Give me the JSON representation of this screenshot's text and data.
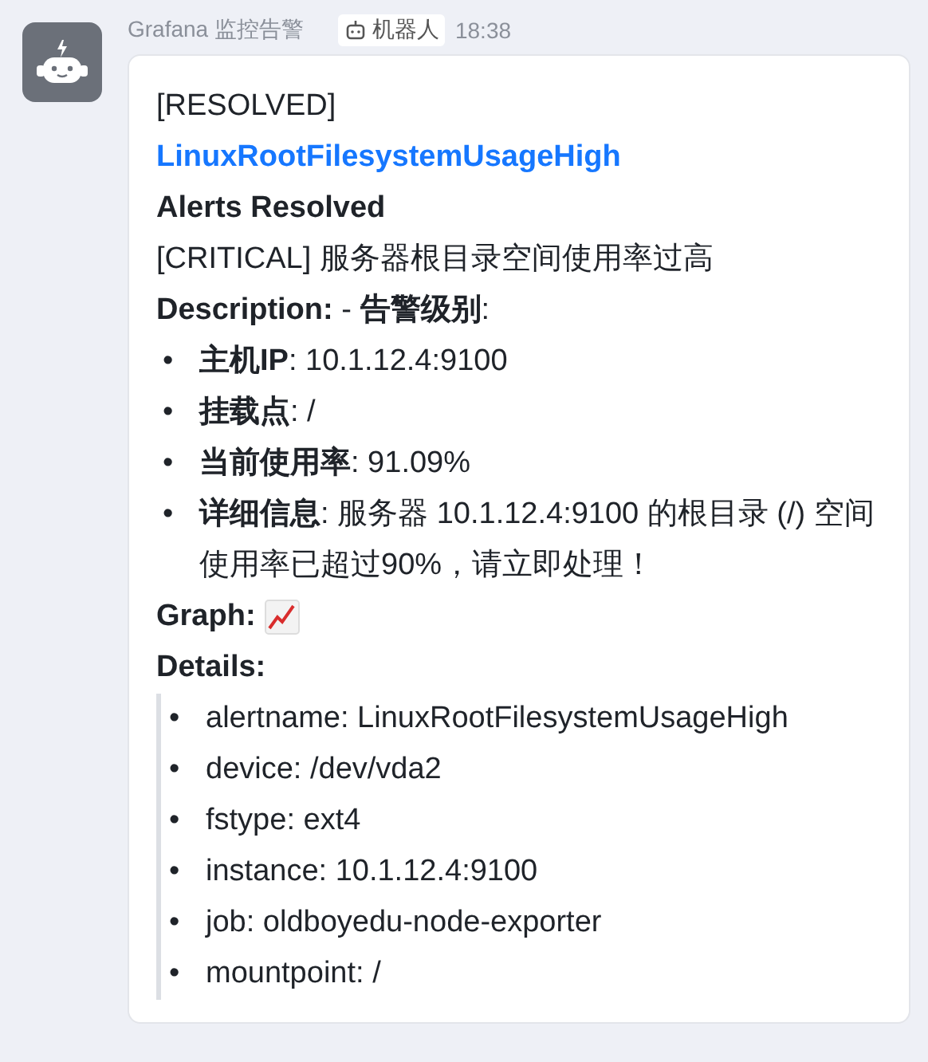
{
  "message": {
    "sender": "Grafana 监控告警",
    "badge": "机器人",
    "time": "18:38",
    "status": "[RESOLVED]",
    "alert_link": "LinuxRootFilesystemUsageHigh",
    "heading": "Alerts Resolved",
    "summary": "[CRITICAL] 服务器根目录空间使用率过高",
    "description": "**Description:** - **告警级别**:",
    "description_items": [
      {
        "marker": "•",
        "text": "**主机IP**: 10.1.12.4:9100"
      },
      {
        "marker": "•",
        "text": "**挂载点**: /"
      },
      {
        "marker": "•",
        "text": "**当前使用率**: 91.09%"
      },
      {
        "marker": "•",
        "text": "**详细信息**: 服务器 10.1.12.4:9100 的根目录 (/) 空间使用率已超过90%，请立即处理！"
      }
    ],
    "graph_label": "Graph:",
    "details_label": "Details:",
    "details": [
      {
        "marker": "•",
        "text": "alertname: LinuxRootFilesystemUsageHigh"
      },
      {
        "marker": "•",
        "text": "device: /dev/vda2"
      },
      {
        "marker": "•",
        "text": "fstype: ext4"
      },
      {
        "marker": "•",
        "text": "instance: 10.1.12.4:9100"
      },
      {
        "marker": "•",
        "text": "job: oldboyedu-node-exporter"
      },
      {
        "marker": "•",
        "text": "mountpoint: /"
      }
    ]
  }
}
